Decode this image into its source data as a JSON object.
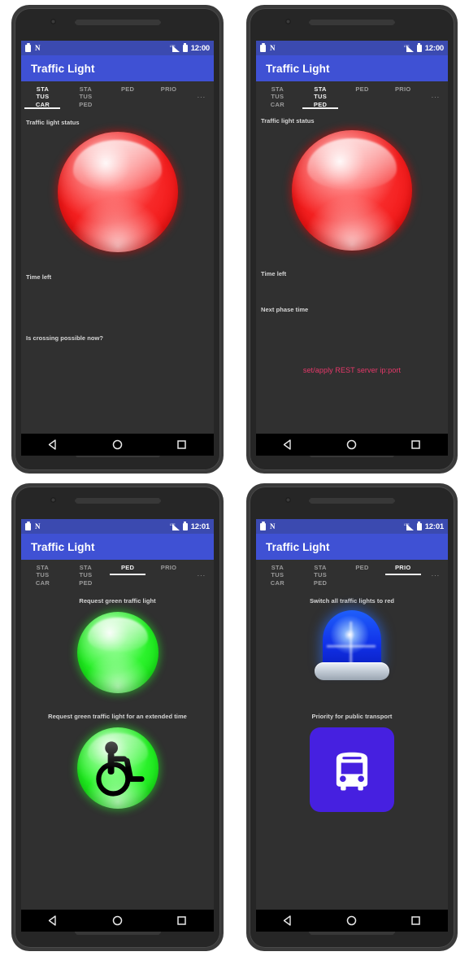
{
  "app": {
    "title": "Traffic Light",
    "accent_appbar": "#3f51d4",
    "accent_statusbar": "#3b4ab0",
    "screen_bg": "#303030",
    "link_color": "#e8386a"
  },
  "status_bar": {
    "icons_left": [
      "clipboard-icon",
      "nfc-icon"
    ],
    "icons_right": [
      "signal-icon",
      "battery-icon"
    ],
    "nfc_glyph": "N",
    "time_1200": "12:00",
    "time_1201": "12:01"
  },
  "tabs": [
    {
      "id": "status-car",
      "lines": [
        "STA",
        "TUS",
        "CAR"
      ]
    },
    {
      "id": "status-ped",
      "lines": [
        "STA",
        "TUS",
        "PED"
      ]
    },
    {
      "id": "ped",
      "lines": [
        "PED"
      ]
    },
    {
      "id": "prio",
      "lines": [
        "PRIO"
      ]
    }
  ],
  "tab_overflow_label": "...",
  "nav_bar": {
    "back": "back-triangle-icon",
    "home": "home-circle-icon",
    "recents": "recents-square-icon"
  },
  "panels": [
    {
      "id": "panel-status-car",
      "selected_tab": 0,
      "time": "12:00",
      "labels": {
        "status": "Traffic light status",
        "time_left": "Time left",
        "crossing": "Is crossing possible now?"
      },
      "light": {
        "name": "red-traffic-light",
        "color": "#f31d1d"
      }
    },
    {
      "id": "panel-status-ped",
      "selected_tab": 1,
      "time": "12:00",
      "labels": {
        "status": "Traffic light status",
        "time_left": "Time left",
        "next_phase": "Next phase time"
      },
      "light": {
        "name": "red-traffic-light",
        "color": "#f31d1d"
      },
      "link": "set/apply REST server ip:port"
    },
    {
      "id": "panel-ped",
      "selected_tab": 2,
      "time": "12:01",
      "labels": {
        "request_green": "Request green traffic light",
        "request_extended": "Request green traffic light for an extended time"
      },
      "buttons": [
        {
          "name": "green-light-button",
          "color": "#22ef22"
        },
        {
          "name": "green-light-wheelchair-button",
          "color": "#22ef22",
          "icon": "wheelchair-icon"
        }
      ]
    },
    {
      "id": "panel-prio",
      "selected_tab": 3,
      "time": "12:01",
      "labels": {
        "switch_red": "Switch all traffic lights to red",
        "priority_transport": "Priority for public transport"
      },
      "buttons": [
        {
          "name": "blue-beacon-button",
          "color": "#1030e8",
          "icon": "emergency-beacon-icon"
        },
        {
          "name": "bus-priority-button",
          "color": "#4620e0",
          "icon": "bus-icon"
        }
      ]
    }
  ]
}
